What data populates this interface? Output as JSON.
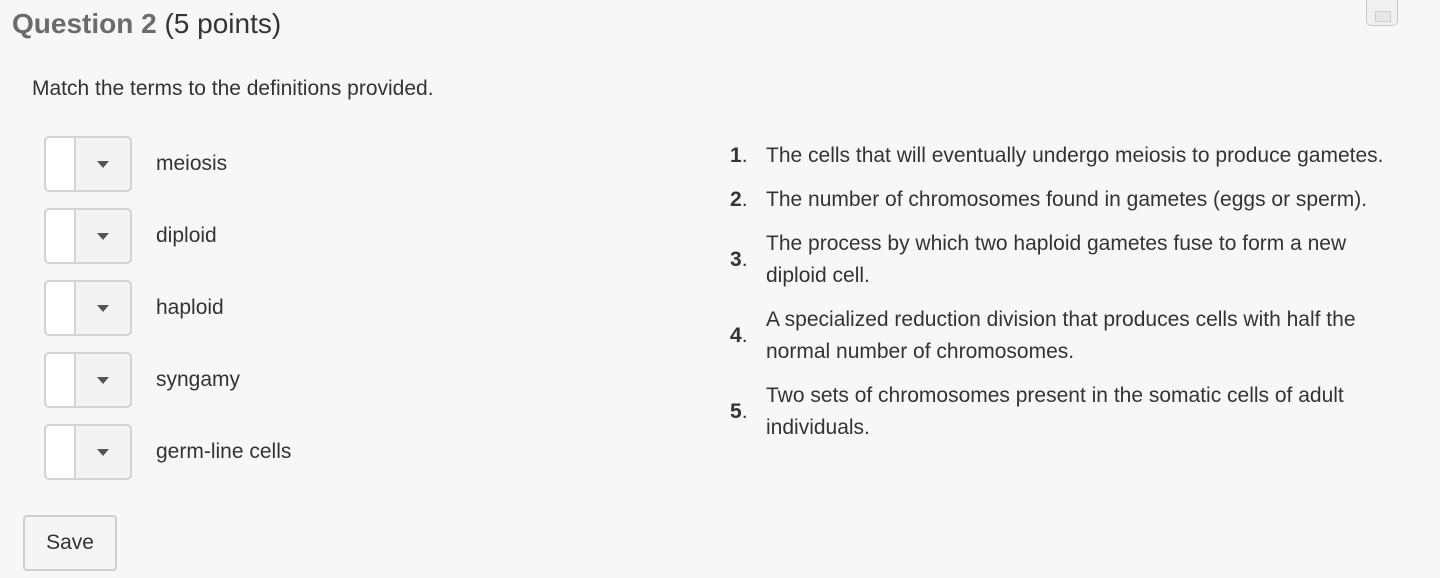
{
  "question": {
    "title": "Question 2",
    "points": "(5 points)"
  },
  "instructions": "Match the terms to the definitions provided.",
  "terms": [
    {
      "label": "meiosis",
      "selected": ""
    },
    {
      "label": "diploid",
      "selected": ""
    },
    {
      "label": "haploid",
      "selected": ""
    },
    {
      "label": "syngamy",
      "selected": ""
    },
    {
      "label": "germ-line cells",
      "selected": ""
    }
  ],
  "definitions": [
    {
      "number": "1",
      "text": "The cells that will eventually undergo meiosis to produce gametes."
    },
    {
      "number": "2",
      "text": "The number of chromosomes found in gametes (eggs or sperm)."
    },
    {
      "number": "3",
      "text": "The process by which two haploid gametes fuse to form a new diploid cell."
    },
    {
      "number": "4",
      "text": "A specialized reduction division that produces cells with half the normal number of chromosomes."
    },
    {
      "number": "5",
      "text": "Two sets of chromosomes present in the somatic cells of adult individuals."
    }
  ],
  "save_label": "Save",
  "icons": {
    "save_indicator": "floppy-disk-icon",
    "dropdown_arrow": "caret-down-icon"
  }
}
